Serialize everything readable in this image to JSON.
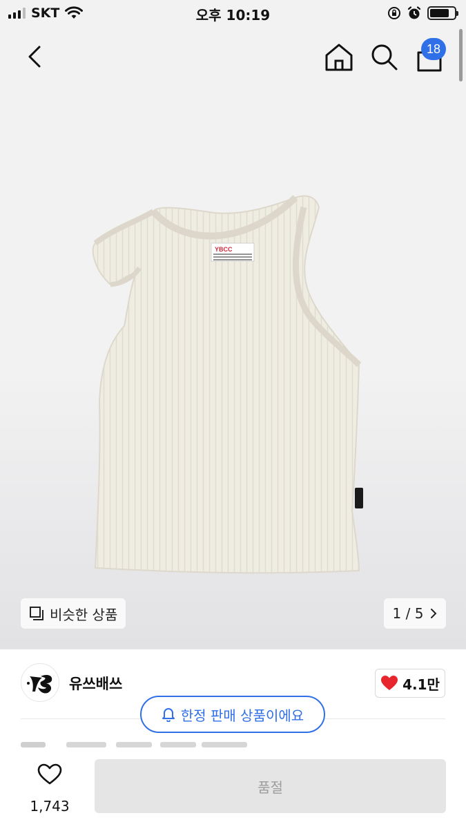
{
  "status_bar": {
    "carrier": "SKT",
    "time": "오후 10:19",
    "battery_level": 0.8,
    "icons": [
      "signal-icon",
      "wifi-icon",
      "orientation-lock-icon",
      "alarm-icon",
      "battery-icon"
    ]
  },
  "header": {
    "back_icon": "chevron-left-icon",
    "home_icon": "home-icon",
    "search_icon": "search-icon",
    "cart_icon": "bag-icon",
    "cart_badge": "18"
  },
  "product_image": {
    "label_text": "YBCC",
    "carousel": {
      "label": "1 / 5",
      "current": 1,
      "total": 5
    }
  },
  "similar_products": {
    "label": "비슷한 상품",
    "icon": "stack-icon"
  },
  "seller": {
    "name": "유쓰배쓰",
    "likes": "4.1만"
  },
  "toast": {
    "text": "한정 판매 상품이에요",
    "icon": "bell-icon"
  },
  "bottom_bar": {
    "wish_count": "1,743",
    "soldout_label": "품절"
  },
  "colors": {
    "accent": "#2f6fe8",
    "heart": "#e8262d",
    "disabled_bg": "#e5e5e5",
    "disabled_text": "#9d9d9d"
  }
}
